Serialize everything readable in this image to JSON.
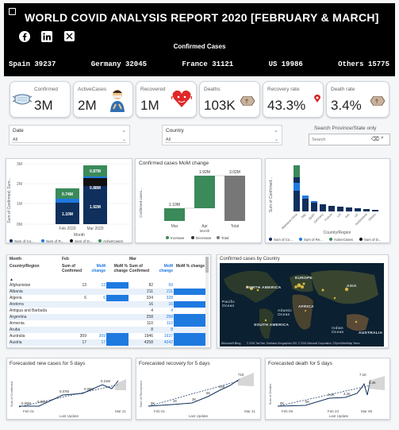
{
  "header": {
    "title": "WORLD COVID ANALYSIS REPORT 2020 [FEBRUARY & MARCH]",
    "subtitle": "Confirmed Cases",
    "ticker": [
      "Spain 39237",
      "Germany 32045",
      "France 31121",
      "US 19986",
      "Others 15775"
    ],
    "social": [
      "facebook-icon",
      "linkedin-icon",
      "x-icon"
    ]
  },
  "kpis": [
    {
      "label": "Confirmed",
      "value": "3M",
      "icon": "mask-icon"
    },
    {
      "label": "ActiveCases",
      "value": "2M",
      "icon": "sick-person-icon"
    },
    {
      "label": "Recovered",
      "value": "1M",
      "icon": "heart-icon"
    },
    {
      "label": "Deaths",
      "value": "103K",
      "icon": "coffin-icon"
    },
    {
      "label": "Recovery rate",
      "value": "43.3%",
      "icon": "pin-icon"
    },
    {
      "label": "Death rate",
      "value": "3.4%",
      "icon": "coffin-icon"
    }
  ],
  "filters": {
    "date": {
      "label": "Date",
      "value": "All"
    },
    "country": {
      "label": "Country",
      "value": "All"
    },
    "search": {
      "label": "Search Province/State only",
      "placeholder": "Search"
    }
  },
  "stacked_chart": {
    "ylabel": "Sum of Confirmed, Sum...",
    "xlabel": "Month",
    "yticks": [
      "0M",
      "1M",
      "2M",
      "3M"
    ],
    "categories": [
      "Feb 2020",
      "Mar 2020"
    ],
    "labels": {
      "feb": [
        "1.10M",
        "0.74M"
      ],
      "mar": [
        "1.92M",
        "0.88M",
        "0.87M"
      ]
    },
    "legend": [
      "Sum of Co...",
      "Sum of R...",
      "Sum of D...",
      "ActiveCases"
    ],
    "colors": [
      "#0f2f5c",
      "#1f7ae0",
      "#111111",
      "#3a8a5a"
    ]
  },
  "waterfall": {
    "title": "Confirmed cases MoM change",
    "ylabel": "Confirmed cases...",
    "xlabel": "Month",
    "categories": [
      "Mar",
      "Apr",
      "Total"
    ],
    "labels": [
      "1.10M",
      "1.92M",
      "3.02M"
    ],
    "legend": [
      "Increase",
      "Decrease",
      "Total"
    ]
  },
  "country_chart": {
    "ylabel": "Sum of Confirmed...",
    "xlabel": "Country/Region",
    "countries": [
      "Mainland China",
      "Italy",
      "Spain",
      "Germany",
      "France",
      "US",
      "Iran",
      "UK",
      "Switzerland",
      "Others"
    ],
    "legend": [
      "Sum of Co...",
      "Sum of Re...",
      "ActiveCases",
      "Sum of D..."
    ]
  },
  "matrix": {
    "headers": {
      "col1": "Month",
      "col1b": "Country/Region",
      "feb": "Feb",
      "mar": "Mar",
      "sum": "Sum of Confirmed",
      "mom": "MoM change",
      "momp": "MoM % change"
    },
    "rows": [
      {
        "c": "Afghanistan",
        "f1": "13",
        "f2": "13",
        "m1": "82",
        "m2": "69"
      },
      {
        "c": "Albania",
        "f1": "",
        "f2": "",
        "m1": "211",
        "m2": "211"
      },
      {
        "c": "Algeria",
        "f1": "6",
        "f2": "6",
        "m1": "334",
        "m2": "328"
      },
      {
        "c": "Andorra",
        "f1": "",
        "f2": "",
        "m1": "16",
        "m2": "16"
      },
      {
        "c": "Antigua and Barbuda",
        "f1": "",
        "f2": "",
        "m1": "4",
        "m2": "4"
      },
      {
        "c": "Argentina",
        "f1": "",
        "f2": "",
        "m1": "258",
        "m2": "258"
      },
      {
        "c": "Armenia",
        "f1": "",
        "f2": "",
        "m1": "110",
        "m2": "110"
      },
      {
        "c": "Aruba",
        "f1": "",
        "f2": "",
        "m1": "8",
        "m2": "8"
      },
      {
        "c": "Australia",
        "f1": "309",
        "f2": "309",
        "m1": "1946",
        "m2": "1637"
      },
      {
        "c": "Austria",
        "f1": "17",
        "f2": "17",
        "m1": "4258",
        "m2": "4242"
      }
    ]
  },
  "map": {
    "title": "Confirmed cases by Country",
    "labels": [
      "NORTH AMERICA",
      "EUROPE",
      "ASIA",
      "AFRICA",
      "SOUTH AMERICA",
      "AUSTRALIA",
      "Pacific Ocean",
      "Atlantic Ocean",
      "Indian Ocean"
    ],
    "footer": "© 2024 TomTom, Earthstar Geographics SIO, © 2024 Microsoft Corporation, ©OpenStreetMap Terms",
    "brand": "Microsoft Bing"
  },
  "forecasts": [
    {
      "title": "Forecasted new cases for 5 days",
      "ylabel": "Sum of Confirmed",
      "x_left": "Feb 01",
      "x_right": "Mar 21",
      "xlabel": "Last Update",
      "points": [
        "0.00M",
        "0.00M",
        "0.07M",
        "0.08M",
        "0.21M"
      ]
    },
    {
      "title": "Forecasted recovery for 5 days",
      "ylabel": "Sum of Recovered",
      "x_left": "Feb 01",
      "x_right": "Mar 21",
      "xlabel": "Last Update",
      "points": [
        "0K",
        "1K",
        "2K",
        "5K",
        "22K",
        "71K"
      ]
    },
    {
      "title": "Forecasted death for 5 days",
      "ylabel": "Sum of Deaths",
      "x_left": "Feb 09",
      "x_mid": "Feb 23",
      "x_right": "Mar 08",
      "xlabel": "Last Update",
      "points": [
        "0K",
        "0K",
        "3.2K",
        "3.2K",
        "7.1K",
        "5.3K"
      ]
    }
  ]
}
